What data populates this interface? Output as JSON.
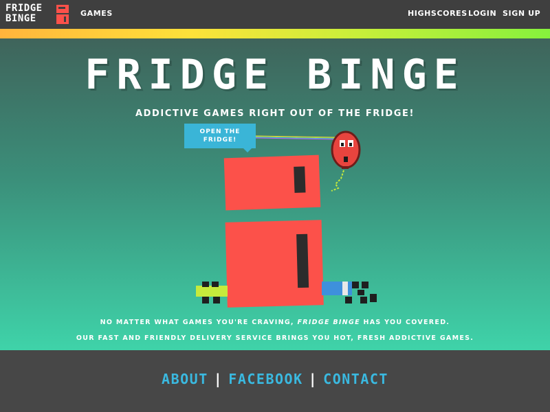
{
  "header": {
    "logo": {
      "line1": "FRIDGE",
      "line2": "BINGE"
    },
    "nav_left": [
      {
        "label": "GAMES"
      }
    ],
    "nav_right": [
      {
        "label": "HIGHSCORES"
      },
      {
        "label": "LOGIN"
      },
      {
        "label": "SIGN UP"
      }
    ]
  },
  "hero": {
    "title": "FRIDGE BINGE",
    "tagline": "ADDICTIVE GAMES RIGHT OUT OF THE FRIDGE!",
    "open_button": {
      "line1": "OPEN THE",
      "line2": "FRIDGE!"
    },
    "description": {
      "line1_before": "NO MATTER WHAT GAMES YOU'RE CRAVING, ",
      "line1_emphasis": "FRIDGE BINGE",
      "line1_after": " HAS YOU COVERED.",
      "line2": "OUR FAST AND FRIENDLY DELIVERY SERVICE BRINGS YOU HOT, FRESH ADDICTIVE GAMES."
    }
  },
  "footer": {
    "links": [
      {
        "label": "ABOUT"
      },
      {
        "label": "FACEBOOK"
      },
      {
        "label": "CONTACT"
      }
    ],
    "separator": "|"
  },
  "colors": {
    "topbar": "#3f3f3f",
    "fridge_red": "#fc514a",
    "accent_blue": "#3ab5d7",
    "footer_link": "#3ab9e0",
    "hero_top": "#3f645b",
    "hero_bottom": "#3fd3a9",
    "lime": "#c6ea3c"
  },
  "icons": {
    "logo_mark": "fridge-logo-icon",
    "balloon": "balloon-face-icon",
    "fridge": "pixel-fridge-icon",
    "left_character": "green-pixel-creature-icon",
    "right_character": "blue-pixel-creature-icon"
  }
}
